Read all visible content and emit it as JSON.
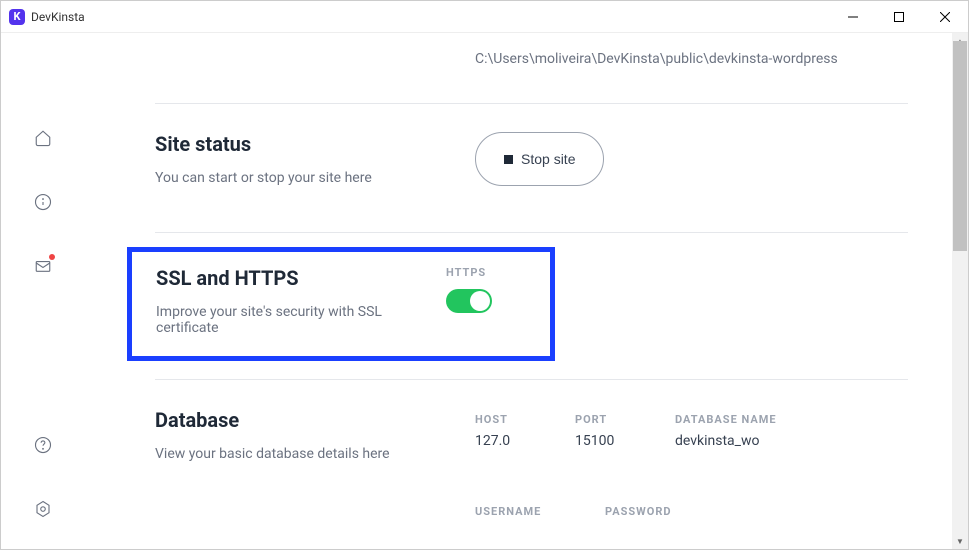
{
  "app": {
    "title": "DevKinsta",
    "icon_letter": "K"
  },
  "path": "C:\\Users\\moliveira\\DevKinsta\\public\\devkinsta-wordpress",
  "site_status": {
    "title": "Site status",
    "subtitle": "You can start or stop your site here",
    "button_label": "Stop site"
  },
  "ssl": {
    "title": "SSL and HTTPS",
    "subtitle": "Improve your site's security with SSL certificate",
    "toggle_label": "HTTPS",
    "enabled": true
  },
  "database": {
    "title": "Database",
    "subtitle": "View your basic database details here",
    "host_label": "HOST",
    "host_value": "127.0",
    "port_label": "PORT",
    "port_value": "15100",
    "name_label": "DATABASE NAME",
    "name_value": "devkinsta_wo"
  },
  "credentials": {
    "username_label": "USERNAME",
    "password_label": "PASSWORD"
  }
}
